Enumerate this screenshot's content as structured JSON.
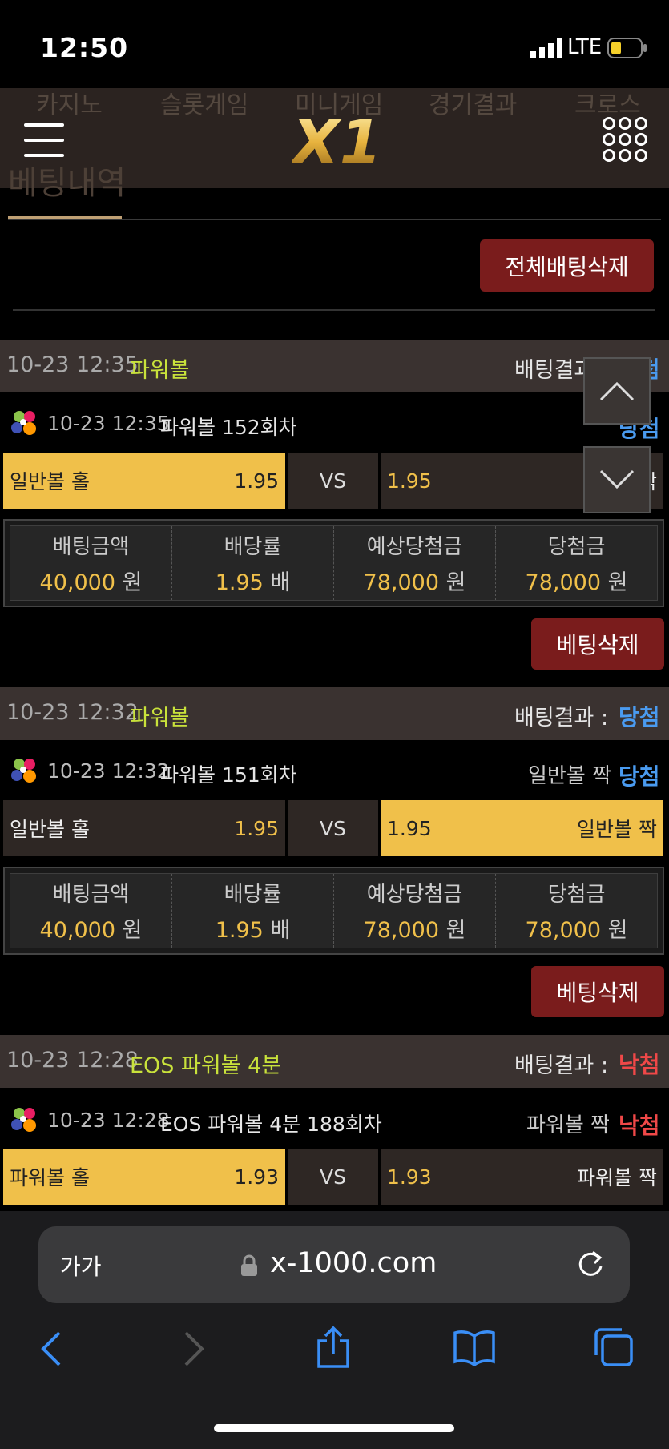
{
  "status_bar": {
    "time": "12:50",
    "network": "LTE",
    "battery_level": 0.35
  },
  "header": {
    "nav_items": [
      "카지노",
      "슬롯게임",
      "미니게임",
      "경기결과",
      "크로스"
    ],
    "logo_text": "X1",
    "page_title": "베팅내역"
  },
  "actions": {
    "delete_all_label": "전체배팅삭제"
  },
  "colors": {
    "accent_gold": "#f0c04a",
    "win_blue": "#4a9bf0",
    "lose_red": "#f04848",
    "game_green": "#c9e23b",
    "delete_red": "#7a1c1c"
  },
  "bets": [
    {
      "datetime": "10-23 12:35",
      "game": "파워볼",
      "result_label": "배팅결과 :",
      "result": "당첨",
      "detail_time": "10-23 12:35",
      "round": "파워볼 152회차",
      "pick": "",
      "left_name": "일반볼 홀",
      "left_odds": "1.95",
      "vs": "VS",
      "right_odds": "1.95",
      "right_name": "짝",
      "info": [
        {
          "label": "배팅금액",
          "value": "40,000",
          "unit": "원"
        },
        {
          "label": "배당률",
          "value": "1.95",
          "unit": "배"
        },
        {
          "label": "예상당첨금",
          "value": "78,000",
          "unit": "원"
        },
        {
          "label": "당첨금",
          "value": "78,000",
          "unit": "원"
        }
      ],
      "delete_label": "베팅삭제"
    },
    {
      "datetime": "10-23 12:32",
      "game": "파워볼",
      "result_label": "배팅결과 :",
      "result": "당첨",
      "detail_time": "10-23 12:32",
      "round": "파워볼 151회차",
      "pick": "일반볼 짝",
      "left_name": "일반볼 홀",
      "left_odds": "1.95",
      "vs": "VS",
      "right_odds": "1.95",
      "right_name": "일반볼 짝",
      "info": [
        {
          "label": "배팅금액",
          "value": "40,000",
          "unit": "원"
        },
        {
          "label": "배당률",
          "value": "1.95",
          "unit": "배"
        },
        {
          "label": "예상당첨금",
          "value": "78,000",
          "unit": "원"
        },
        {
          "label": "당첨금",
          "value": "78,000",
          "unit": "원"
        }
      ],
      "delete_label": "베팅삭제"
    },
    {
      "datetime": "10-23 12:28",
      "game": "EOS 파워볼 4분",
      "result_label": "배팅결과 :",
      "result": "낙첨",
      "detail_time": "10-23 12:28",
      "round": "EOS 파워볼 4분 188회차",
      "pick": "파워볼 짝",
      "left_name": "파워볼 홀",
      "left_odds": "1.93",
      "vs": "VS",
      "right_odds": "1.93",
      "right_name": "파워볼 짝"
    }
  ],
  "browser": {
    "text_size_label": "가가",
    "url": "x-1000.com"
  }
}
